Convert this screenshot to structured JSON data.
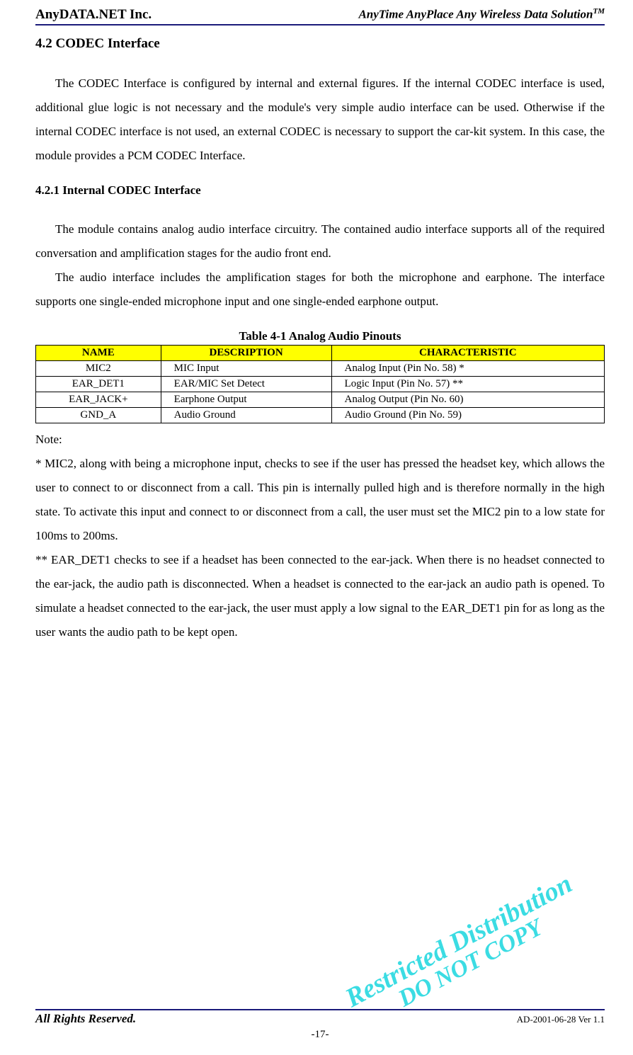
{
  "header": {
    "company": "AnyDATA.NET Inc.",
    "tagline_base": "AnyTime AnyPlace Any Wireless Data Solution",
    "tagline_sup": "TM"
  },
  "section_heading": "4.2 CODEC Interface",
  "para1": "The CODEC Interface is configured by internal and external figures. If the internal CODEC interface is used, additional glue logic is not necessary and the module's very simple audio interface can be used. Otherwise if the internal CODEC interface is not used, an external CODEC is necessary to support the car-kit system. In this case, the module provides a PCM CODEC Interface.",
  "sub_heading": "4.2.1 Internal CODEC Interface",
  "para2": "The module contains analog audio interface circuitry. The contained audio interface supports all of the required conversation and amplification stages for the audio front end.",
  "para3": "The audio interface includes the amplification stages for both the microphone and earphone. The interface supports one single-ended microphone input and one single-ended earphone output.",
  "table_caption": "Table 4-1 Analog Audio Pinouts",
  "table": {
    "headers": [
      "NAME",
      "DESCRIPTION",
      "CHARACTERISTIC"
    ],
    "rows": [
      {
        "name": "MIC2",
        "desc": "MIC Input",
        "char": "Analog Input    (Pin No. 58) *"
      },
      {
        "name": "EAR_DET1",
        "desc": "EAR/MIC Set Detect",
        "char": "Logic Input      (Pin No. 57) **"
      },
      {
        "name": "EAR_JACK+",
        "desc": "Earphone Output",
        "char": "Analog Output (Pin No. 60)"
      },
      {
        "name": "GND_A",
        "desc": "Audio Ground",
        "char": "Audio Ground (Pin No. 59)"
      }
    ]
  },
  "note_label": "Note:",
  "note1": "* MIC2, along with being a microphone input, checks to see if the user has pressed the headset key, which allows the user to connect to or disconnect from a call. This pin is internally pulled high and is therefore normally in the high state. To activate this input and connect to or disconnect from a call, the user must set the MIC2 pin to a low state for 100ms to 200ms.",
  "note2": "** EAR_DET1 checks to see if a headset has been connected to the ear-jack. When there is no headset connected to the ear-jack, the audio path is disconnected. When a headset is connected to the ear-jack an audio path is opened. To simulate a headset connected to the ear-jack, the user must apply a low signal to the EAR_DET1 pin for as long as the user wants the audio path to be kept open.",
  "watermark": {
    "line1": "Restricted Distribution",
    "line2": "DO NOT COPY"
  },
  "footer": {
    "left": "All Rights Reserved.",
    "right": "AD-2001-06-28 Ver 1.1",
    "center": "-17-"
  }
}
